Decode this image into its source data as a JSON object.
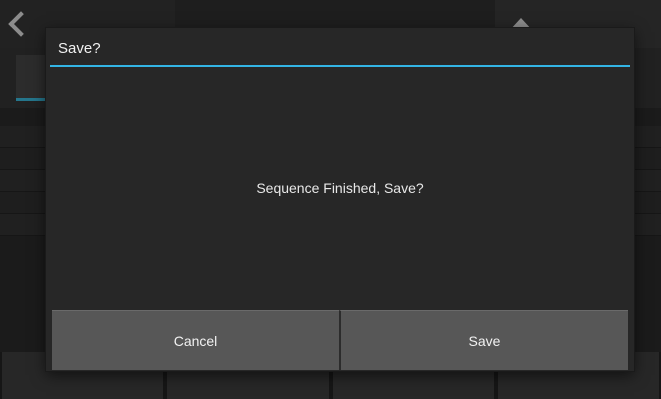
{
  "dialog": {
    "title": "Save?",
    "message": "Sequence Finished, Save?",
    "cancel_label": "Cancel",
    "save_label": "Save"
  },
  "colors": {
    "accent": "#33b5e5",
    "dialog_bg": "#272727",
    "button_bg": "#575757"
  }
}
